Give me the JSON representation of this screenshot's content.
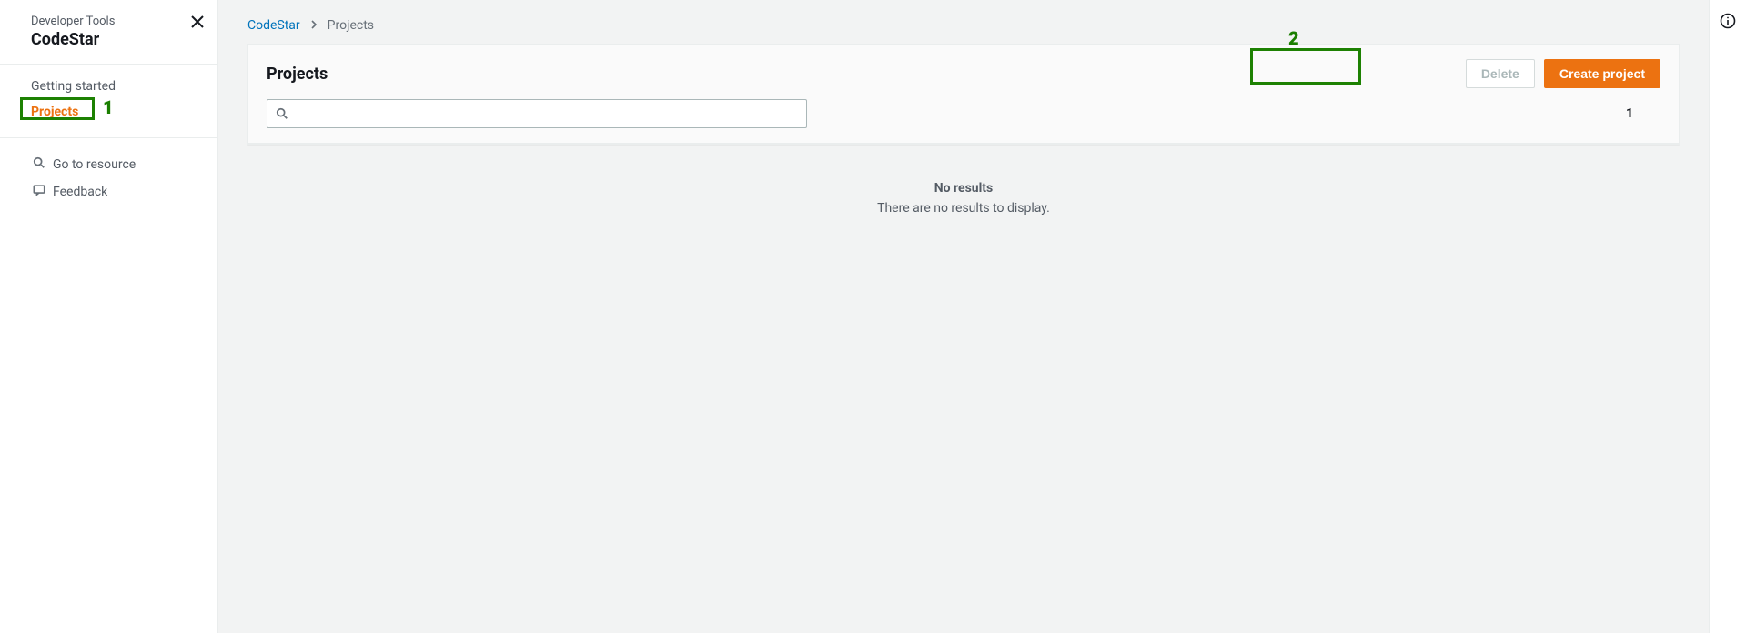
{
  "sidebar": {
    "subtitle": "Developer Tools",
    "title": "CodeStar",
    "nav": {
      "getting_started": "Getting started",
      "projects": "Projects"
    },
    "foot": {
      "go_to_resource": "Go to resource",
      "feedback": "Feedback"
    }
  },
  "breadcrumb": {
    "root": "CodeStar",
    "current": "Projects"
  },
  "panel": {
    "title": "Projects",
    "buttons": {
      "delete": "Delete",
      "create": "Create project"
    },
    "pagination": {
      "page": "1"
    }
  },
  "empty": {
    "title": "No results",
    "subtitle": "There are no results to display."
  },
  "annotations": {
    "one": "1",
    "two": "2"
  }
}
